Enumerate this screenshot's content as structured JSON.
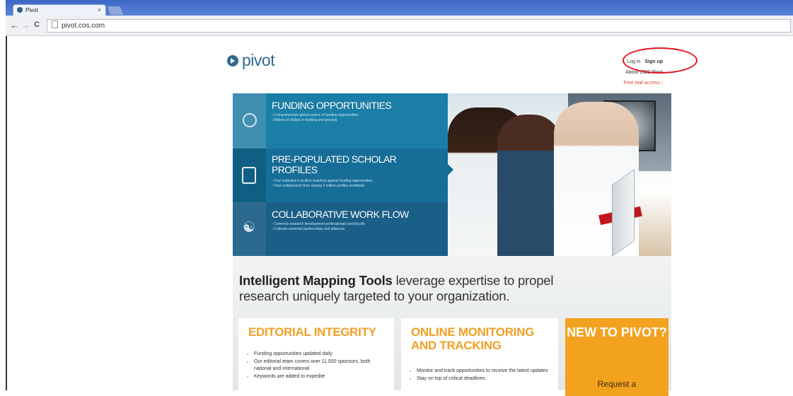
{
  "browser": {
    "tab_title": "Pivot",
    "tab_close": "×",
    "back": "←",
    "forward": "→",
    "reload": "C",
    "url": "pivot.cos.com"
  },
  "site": {
    "logo_text": "pivot",
    "links": {
      "login": "Log in",
      "signup": "Sign up",
      "about": "About COS Pivot",
      "trial": "Free trial access ›"
    }
  },
  "hero": {
    "panels": [
      {
        "title": "FUNDING OPPORTUNITIES",
        "bullets": [
          "Comprehensive global source of funding opportunities",
          "Billions of dollars in funding and growing"
        ]
      },
      {
        "title": "PRE-POPULATED SCHOLAR PROFILES",
        "bullets": [
          "Your institution's profiles matched against funding opportunities",
          "Find collaborators from among 3 million profiles worldwide"
        ]
      },
      {
        "title": "COLLABORATIVE WORK FLOW",
        "bullets": [
          "Connects research development professionals and faculty",
          "Cultivate essential partnerships and alliances"
        ]
      }
    ]
  },
  "intro": {
    "bold": "Intelligent Mapping Tools",
    "rest": " leverage expertise to propel research uniquely targeted to your organization."
  },
  "cards": {
    "editorial": {
      "title": "EDITORIAL INTEGRITY",
      "items": [
        "Funding opportunities updated daily",
        "Our editorial team covers over 11,500 sponsors, both national and international",
        "Keywords are added to expedite"
      ]
    },
    "monitoring": {
      "title": "ONLINE MONITORING AND TRACKING",
      "items": [
        "Monitor and track opportunities to receive the latest updates",
        "Stay on top of critical deadlines"
      ]
    },
    "new": {
      "title": "NEW TO PIVOT?",
      "request": "Request a"
    }
  },
  "colors": {
    "annotation_circle": "#e0141e",
    "accent_orange": "#f0a026",
    "panel_blue": "#166d98"
  }
}
